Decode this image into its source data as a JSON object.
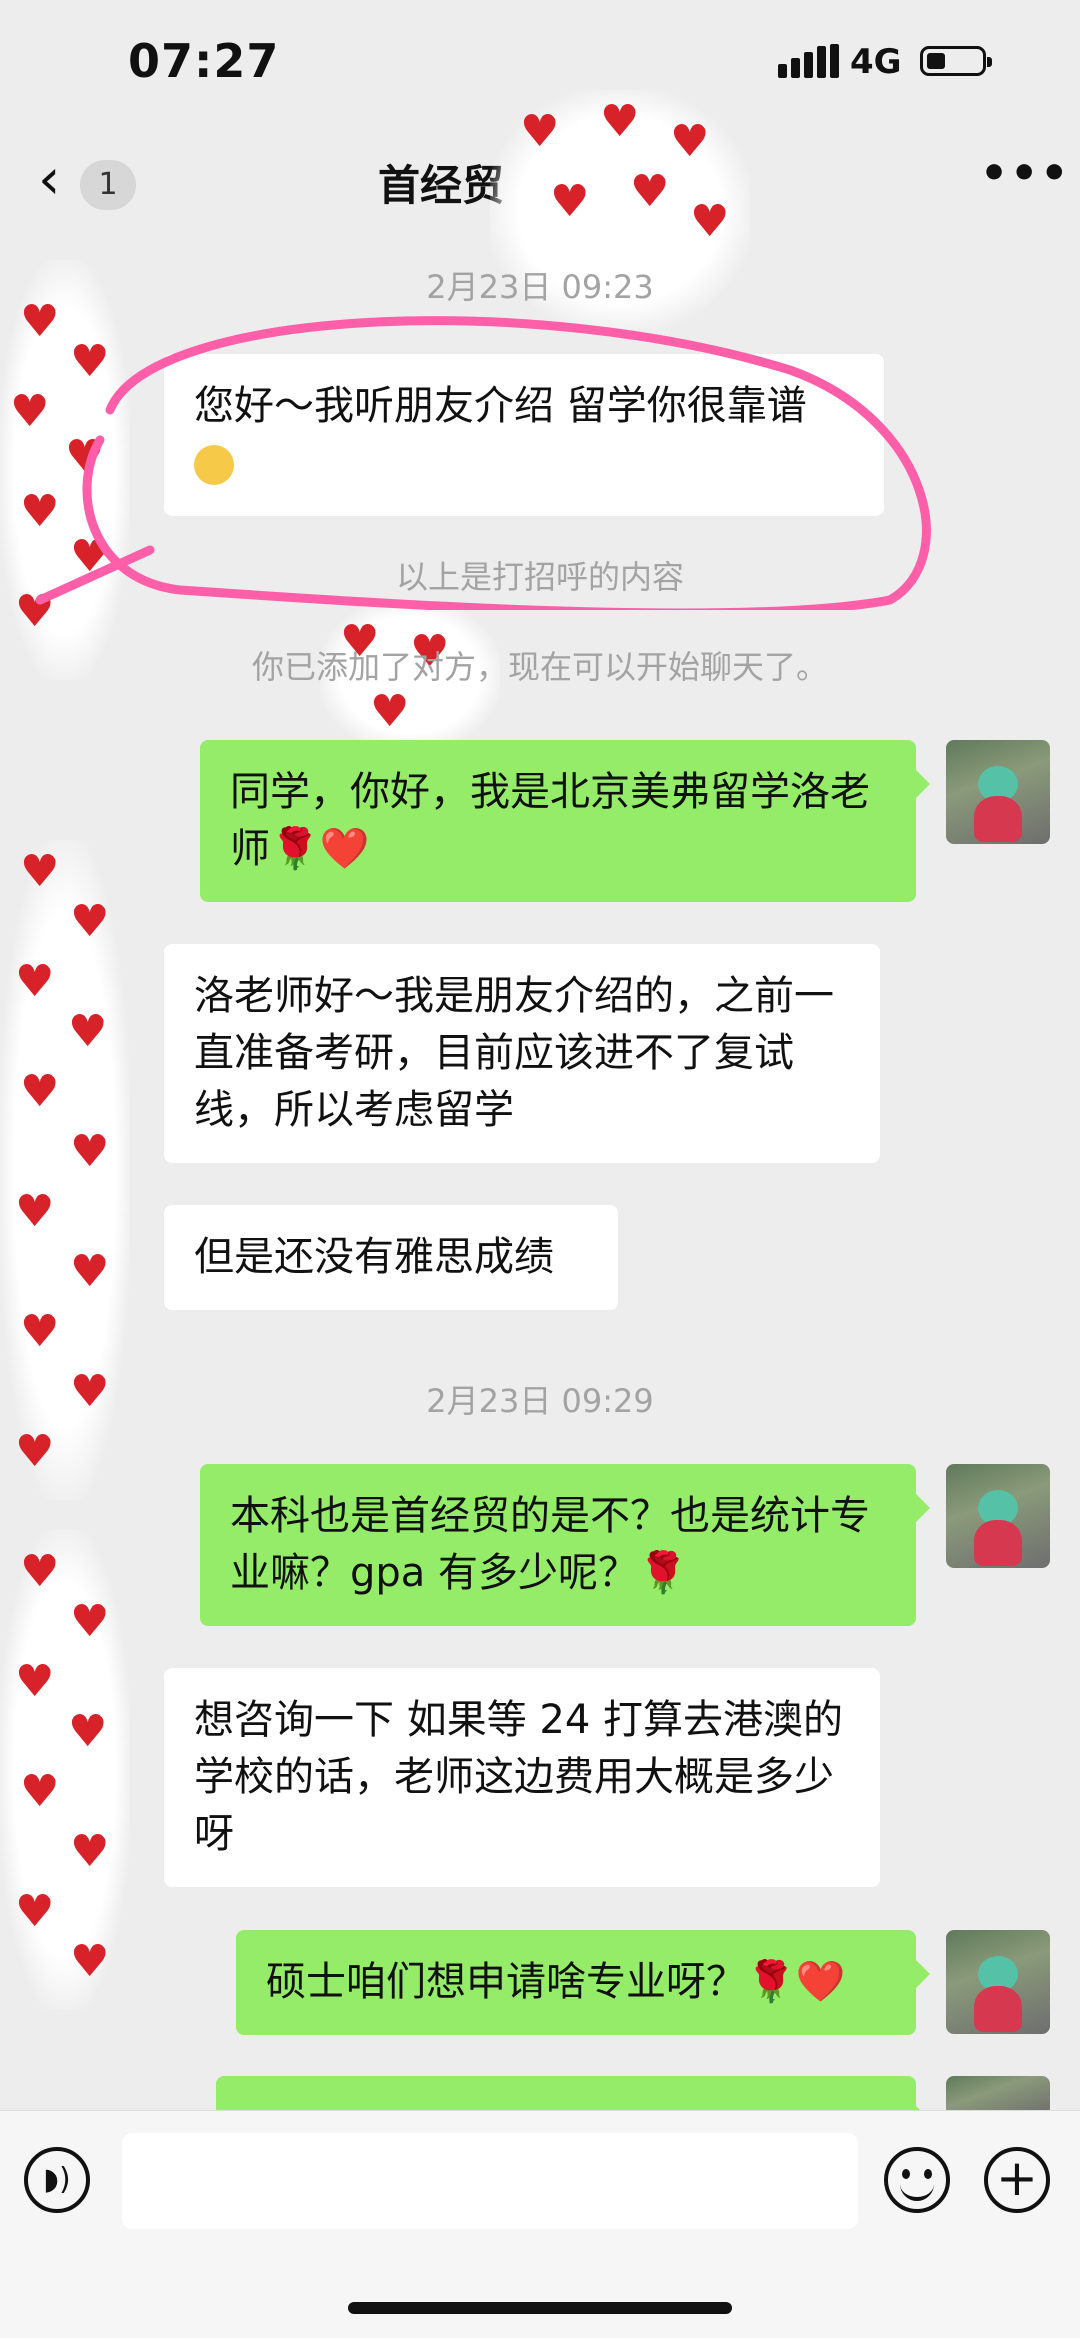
{
  "status": {
    "time": "07:27",
    "network": "4G"
  },
  "nav": {
    "badge": "1",
    "title": "首经贸"
  },
  "chat": {
    "ts1": "2月23日 09:23",
    "greeting": "您好～我听朋友介绍 留学你很靠谱",
    "sys1": "以上是打招呼的内容",
    "sys2": "你已添加了对方，现在可以开始聊天了。",
    "msg1": "同学，你好，我是北京美弗留学洛老师",
    "msg1_emoji": "🌹❤️",
    "msg2": "洛老师好～我是朋友介绍的，之前一直准备考研，目前应该进不了复试线，所以考虑留学",
    "msg3": "但是还没有雅思成绩",
    "ts2": "2月23日 09:29",
    "msg4": "本科也是首经贸的是不？也是统计专业嘛？gpa 有多少呢？",
    "msg4_emoji": "🌹",
    "msg5": "想咨询一下 如果等 24 打算去港澳的学校的话，老师这边费用大概是多少呀",
    "msg6": "硕士咱们想申请啥专业呀？",
    "msg6_emoji": "🌹❤️"
  },
  "icons": {
    "back": "chevron-left-icon",
    "more": "more-dots-icon",
    "voice": "voice-icon",
    "emoji": "emoji-icon",
    "plus": "plus-icon"
  },
  "colors": {
    "background": "#ededed",
    "outgoing_bubble": "#95ec69",
    "incoming_bubble": "#ffffff",
    "annotation": "#ff5fa8",
    "hearts": "#d8222a"
  }
}
